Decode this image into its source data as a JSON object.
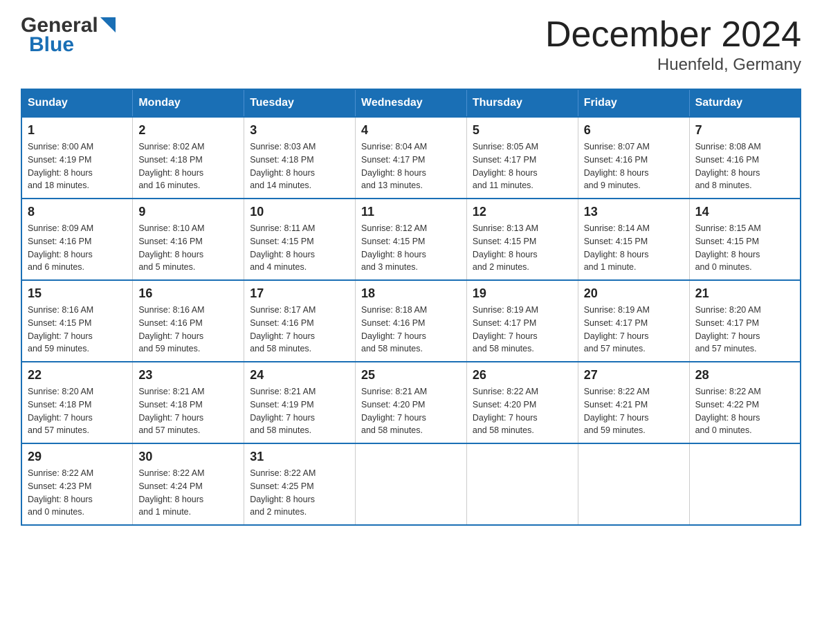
{
  "logo": {
    "general": "General",
    "blue": "Blue"
  },
  "title": "December 2024",
  "location": "Huenfeld, Germany",
  "days_of_week": [
    "Sunday",
    "Monday",
    "Tuesday",
    "Wednesday",
    "Thursday",
    "Friday",
    "Saturday"
  ],
  "weeks": [
    [
      {
        "date": "1",
        "sunrise": "Sunrise: 8:00 AM",
        "sunset": "Sunset: 4:19 PM",
        "daylight": "Daylight: 8 hours and 18 minutes."
      },
      {
        "date": "2",
        "sunrise": "Sunrise: 8:02 AM",
        "sunset": "Sunset: 4:18 PM",
        "daylight": "Daylight: 8 hours and 16 minutes."
      },
      {
        "date": "3",
        "sunrise": "Sunrise: 8:03 AM",
        "sunset": "Sunset: 4:18 PM",
        "daylight": "Daylight: 8 hours and 14 minutes."
      },
      {
        "date": "4",
        "sunrise": "Sunrise: 8:04 AM",
        "sunset": "Sunset: 4:17 PM",
        "daylight": "Daylight: 8 hours and 13 minutes."
      },
      {
        "date": "5",
        "sunrise": "Sunrise: 8:05 AM",
        "sunset": "Sunset: 4:17 PM",
        "daylight": "Daylight: 8 hours and 11 minutes."
      },
      {
        "date": "6",
        "sunrise": "Sunrise: 8:07 AM",
        "sunset": "Sunset: 4:16 PM",
        "daylight": "Daylight: 8 hours and 9 minutes."
      },
      {
        "date": "7",
        "sunrise": "Sunrise: 8:08 AM",
        "sunset": "Sunset: 4:16 PM",
        "daylight": "Daylight: 8 hours and 8 minutes."
      }
    ],
    [
      {
        "date": "8",
        "sunrise": "Sunrise: 8:09 AM",
        "sunset": "Sunset: 4:16 PM",
        "daylight": "Daylight: 8 hours and 6 minutes."
      },
      {
        "date": "9",
        "sunrise": "Sunrise: 8:10 AM",
        "sunset": "Sunset: 4:16 PM",
        "daylight": "Daylight: 8 hours and 5 minutes."
      },
      {
        "date": "10",
        "sunrise": "Sunrise: 8:11 AM",
        "sunset": "Sunset: 4:15 PM",
        "daylight": "Daylight: 8 hours and 4 minutes."
      },
      {
        "date": "11",
        "sunrise": "Sunrise: 8:12 AM",
        "sunset": "Sunset: 4:15 PM",
        "daylight": "Daylight: 8 hours and 3 minutes."
      },
      {
        "date": "12",
        "sunrise": "Sunrise: 8:13 AM",
        "sunset": "Sunset: 4:15 PM",
        "daylight": "Daylight: 8 hours and 2 minutes."
      },
      {
        "date": "13",
        "sunrise": "Sunrise: 8:14 AM",
        "sunset": "Sunset: 4:15 PM",
        "daylight": "Daylight: 8 hours and 1 minute."
      },
      {
        "date": "14",
        "sunrise": "Sunrise: 8:15 AM",
        "sunset": "Sunset: 4:15 PM",
        "daylight": "Daylight: 8 hours and 0 minutes."
      }
    ],
    [
      {
        "date": "15",
        "sunrise": "Sunrise: 8:16 AM",
        "sunset": "Sunset: 4:15 PM",
        "daylight": "Daylight: 7 hours and 59 minutes."
      },
      {
        "date": "16",
        "sunrise": "Sunrise: 8:16 AM",
        "sunset": "Sunset: 4:16 PM",
        "daylight": "Daylight: 7 hours and 59 minutes."
      },
      {
        "date": "17",
        "sunrise": "Sunrise: 8:17 AM",
        "sunset": "Sunset: 4:16 PM",
        "daylight": "Daylight: 7 hours and 58 minutes."
      },
      {
        "date": "18",
        "sunrise": "Sunrise: 8:18 AM",
        "sunset": "Sunset: 4:16 PM",
        "daylight": "Daylight: 7 hours and 58 minutes."
      },
      {
        "date": "19",
        "sunrise": "Sunrise: 8:19 AM",
        "sunset": "Sunset: 4:17 PM",
        "daylight": "Daylight: 7 hours and 58 minutes."
      },
      {
        "date": "20",
        "sunrise": "Sunrise: 8:19 AM",
        "sunset": "Sunset: 4:17 PM",
        "daylight": "Daylight: 7 hours and 57 minutes."
      },
      {
        "date": "21",
        "sunrise": "Sunrise: 8:20 AM",
        "sunset": "Sunset: 4:17 PM",
        "daylight": "Daylight: 7 hours and 57 minutes."
      }
    ],
    [
      {
        "date": "22",
        "sunrise": "Sunrise: 8:20 AM",
        "sunset": "Sunset: 4:18 PM",
        "daylight": "Daylight: 7 hours and 57 minutes."
      },
      {
        "date": "23",
        "sunrise": "Sunrise: 8:21 AM",
        "sunset": "Sunset: 4:18 PM",
        "daylight": "Daylight: 7 hours and 57 minutes."
      },
      {
        "date": "24",
        "sunrise": "Sunrise: 8:21 AM",
        "sunset": "Sunset: 4:19 PM",
        "daylight": "Daylight: 7 hours and 58 minutes."
      },
      {
        "date": "25",
        "sunrise": "Sunrise: 8:21 AM",
        "sunset": "Sunset: 4:20 PM",
        "daylight": "Daylight: 7 hours and 58 minutes."
      },
      {
        "date": "26",
        "sunrise": "Sunrise: 8:22 AM",
        "sunset": "Sunset: 4:20 PM",
        "daylight": "Daylight: 7 hours and 58 minutes."
      },
      {
        "date": "27",
        "sunrise": "Sunrise: 8:22 AM",
        "sunset": "Sunset: 4:21 PM",
        "daylight": "Daylight: 7 hours and 59 minutes."
      },
      {
        "date": "28",
        "sunrise": "Sunrise: 8:22 AM",
        "sunset": "Sunset: 4:22 PM",
        "daylight": "Daylight: 8 hours and 0 minutes."
      }
    ],
    [
      {
        "date": "29",
        "sunrise": "Sunrise: 8:22 AM",
        "sunset": "Sunset: 4:23 PM",
        "daylight": "Daylight: 8 hours and 0 minutes."
      },
      {
        "date": "30",
        "sunrise": "Sunrise: 8:22 AM",
        "sunset": "Sunset: 4:24 PM",
        "daylight": "Daylight: 8 hours and 1 minute."
      },
      {
        "date": "31",
        "sunrise": "Sunrise: 8:22 AM",
        "sunset": "Sunset: 4:25 PM",
        "daylight": "Daylight: 8 hours and 2 minutes."
      },
      null,
      null,
      null,
      null
    ]
  ]
}
